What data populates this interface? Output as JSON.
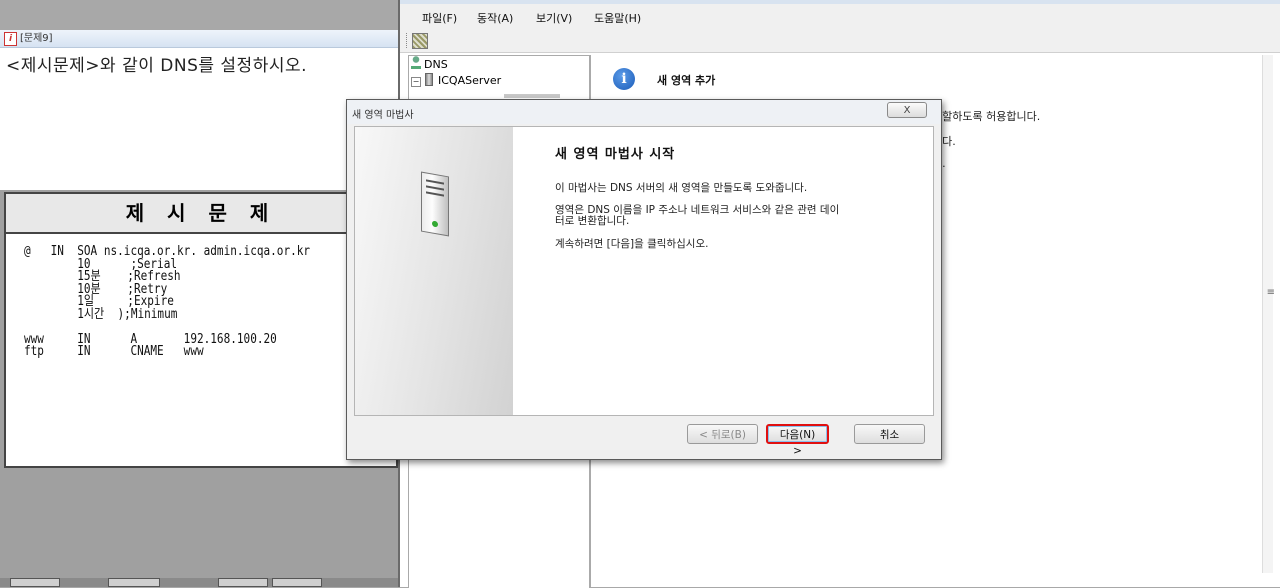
{
  "question_window": {
    "title": "[문제9]",
    "question": "<제시문제>와 같이 DNS를 설정하시오.",
    "sample_heading": "제 시 문 제",
    "sample_lines": [
      "@   IN  SOA ns.icqa.or.kr. admin.icqa.or.kr",
      "        10      ;Serial",
      "        15분    ;Refresh",
      "        10분    ;Retry",
      "        1일     ;Expire",
      "        1시간  );Minimum",
      "",
      "www     IN      A       192.168.100.20",
      "ftp     IN      CNAME   www"
    ]
  },
  "mmc": {
    "menu": [
      "파일(F)",
      "동작(A)",
      "보기(V)",
      "도움말(H)"
    ],
    "tree": {
      "root": "DNS",
      "server": "ICQAServer"
    },
    "detail": {
      "title": "새 영역 추가",
      "fragments": [
        "분할하도록 허용합니다.",
        "니다.",
        "오."
      ]
    }
  },
  "wizard": {
    "title": "새 영역 마법사",
    "close_label": "X",
    "heading": "새 영역 마법사 시작",
    "para1": "이 마법사는 DNS 서버의 새 영역을 만들도록 도와줍니다.",
    "para2_line1": "영역은 DNS 이름을 IP 주소나 네트워크 서비스와 같은 관련 데이",
    "para2_line2": "터로 변환합니다.",
    "para3": "계속하려면 [다음]을 클릭하십시오.",
    "buttons": {
      "back": "< 뒤로(B)",
      "next": "다음(N) >",
      "cancel": "취소"
    }
  }
}
